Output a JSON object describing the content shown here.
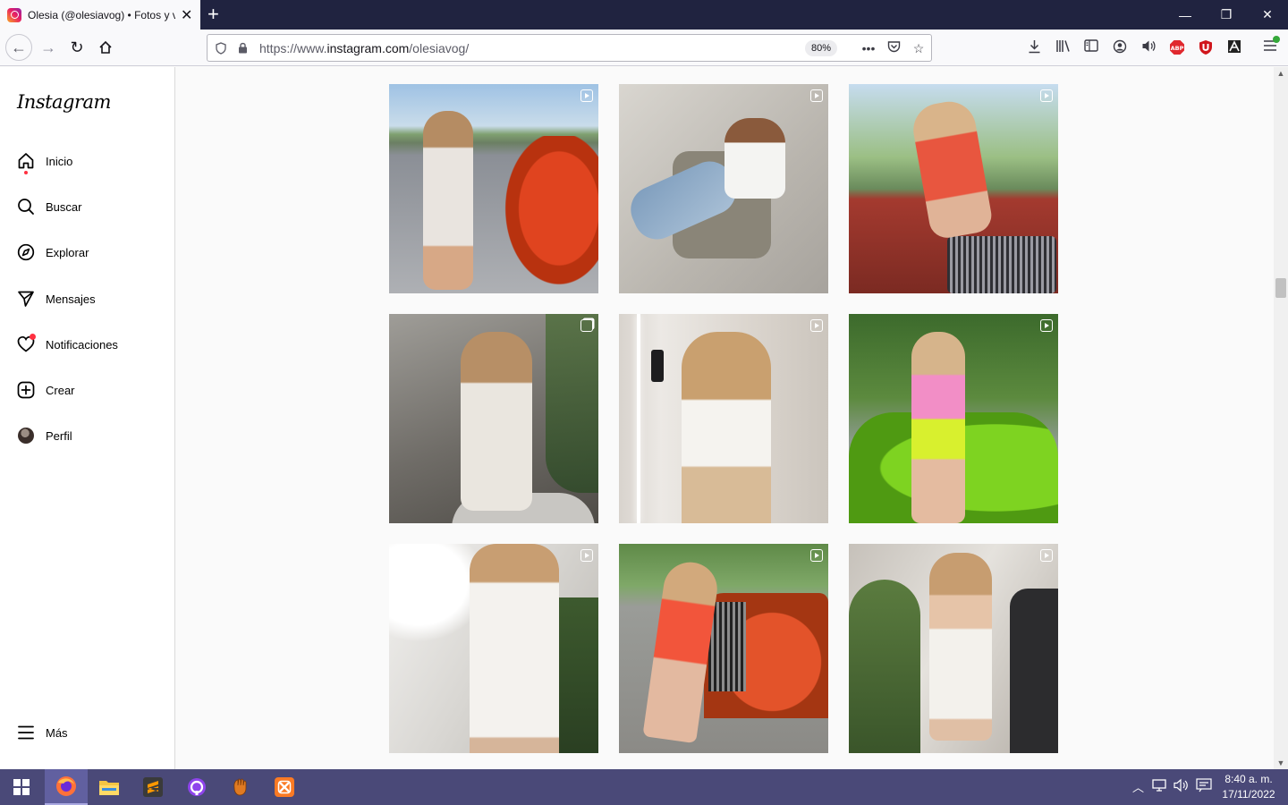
{
  "browser": {
    "tab_title": "Olesia (@olesiavog) • Fotos y videos de Instagram",
    "url_prefix": "https://www.",
    "url_domain": "instagram.com",
    "url_path": "/olesiavog/",
    "zoom": "80%",
    "new_tab_label": "+",
    "minimize_label": "—",
    "restore_label": "❐",
    "close_label": "✕"
  },
  "app": {
    "logo": "Instagram"
  },
  "sidebar": {
    "items": [
      {
        "label": "Inicio",
        "icon": "home-icon"
      },
      {
        "label": "Buscar",
        "icon": "search-icon"
      },
      {
        "label": "Explorar",
        "icon": "compass-icon"
      },
      {
        "label": "Mensajes",
        "icon": "send-icon"
      },
      {
        "label": "Notificaciones",
        "icon": "heart-icon"
      },
      {
        "label": "Crear",
        "icon": "plus-square-icon"
      },
      {
        "label": "Perfil",
        "icon": "avatar"
      }
    ],
    "more_label": "Más"
  },
  "grid": {
    "posts": [
      {
        "type": "reel",
        "subject": "woman in printed dress beside red SUV"
      },
      {
        "type": "reel",
        "subject": "woman in white blazer on chair with phone"
      },
      {
        "type": "reel",
        "subject": "woman in red dress on red car hood"
      },
      {
        "type": "carousel",
        "subject": "woman in white two-piece near plants"
      },
      {
        "type": "reel",
        "subject": "woman taking mirror selfie in corset"
      },
      {
        "type": "reel",
        "subject": "woman in pink top beside green car"
      },
      {
        "type": "reel",
        "subject": "woman in white dress with flowing fabric"
      },
      {
        "type": "reel",
        "subject": "woman in red dress leaning on orange SUV"
      },
      {
        "type": "reel",
        "subject": "woman in white open-back dress near plants"
      }
    ]
  },
  "taskbar": {
    "time": "8:40 a. m.",
    "date": "17/11/2022",
    "apps": [
      "windows-start",
      "firefox",
      "file-explorer",
      "sublime-text",
      "github-desktop",
      "baseball-glove-app",
      "xampp"
    ]
  }
}
